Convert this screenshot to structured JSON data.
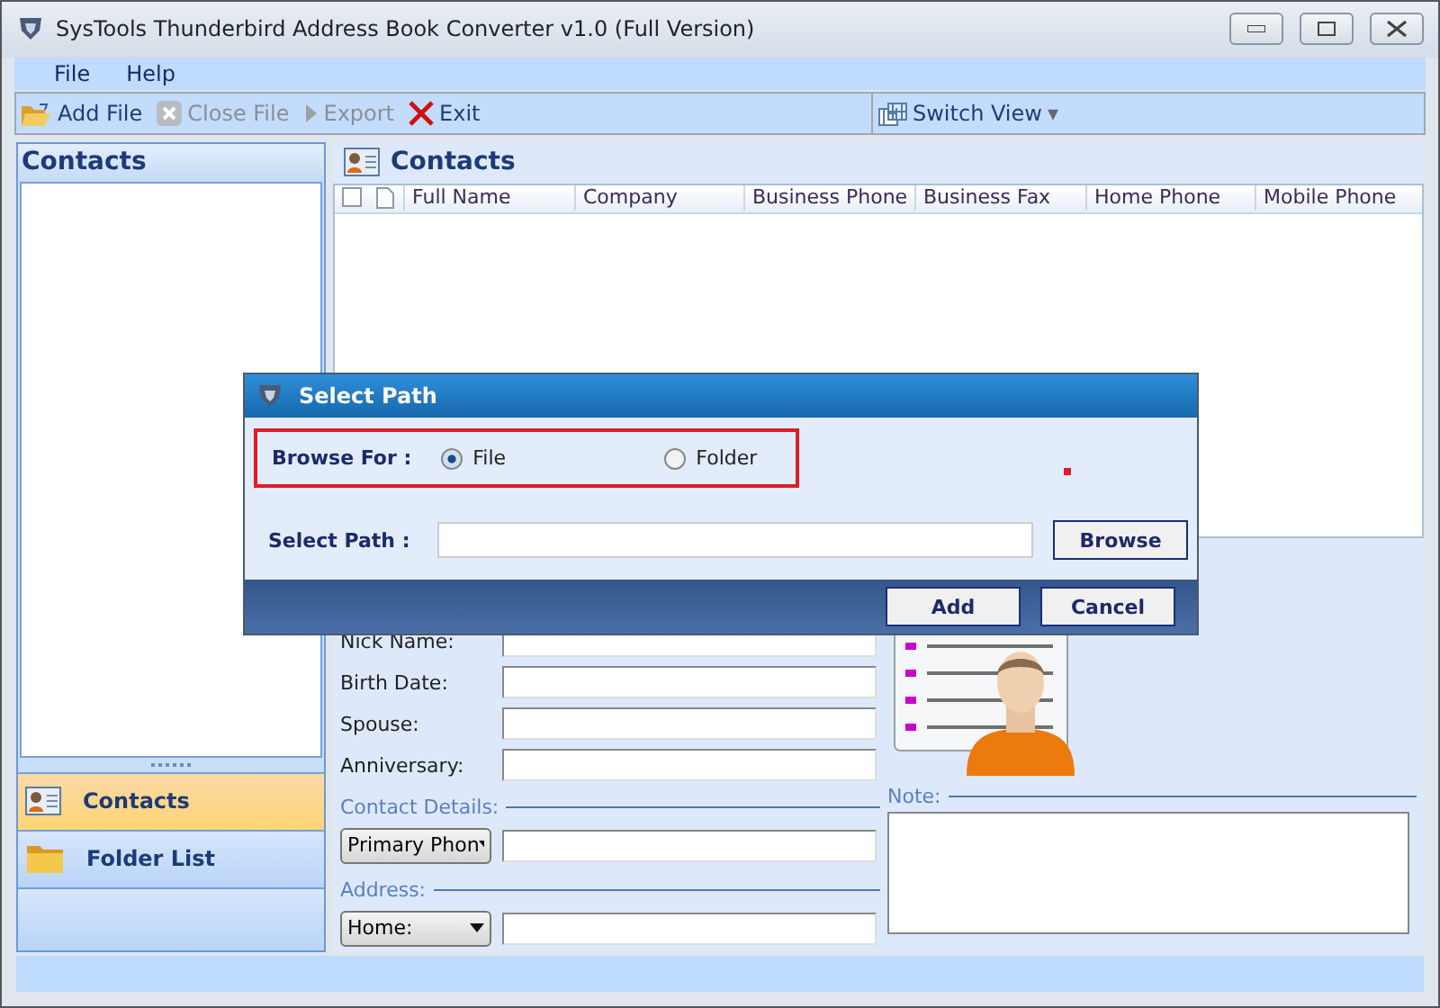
{
  "window": {
    "title": "SysTools Thunderbird Address Book Converter v1.0 (Full Version)"
  },
  "menu": [
    "File",
    "Help"
  ],
  "toolbar": [
    {
      "kind": "add",
      "label": "Add File",
      "disabled": false
    },
    {
      "kind": "close",
      "label": "Close File",
      "disabled": true
    },
    {
      "kind": "export",
      "label": "Export",
      "disabled": true
    },
    {
      "kind": "exit",
      "label": "Exit",
      "disabled": false
    }
  ],
  "switch_view": {
    "label": "Switch View",
    "caret": "▾"
  },
  "left_pane": {
    "title": "Contacts",
    "nav": [
      {
        "kind": "contacts",
        "label": "Contacts",
        "selected": true
      },
      {
        "kind": "folder",
        "label": "Folder List",
        "selected": false
      }
    ]
  },
  "main": {
    "title": "Contacts",
    "select_all": {
      "checked": false
    },
    "columns": [
      "Full Name",
      "Company",
      "Business Phone",
      "Business Fax",
      "Home Phone",
      "Mobile Phone"
    ],
    "fields": [
      "Nick Name:",
      "Birth Date:",
      "Spouse:",
      "Anniversary:"
    ],
    "contact_details": {
      "label": "Contact Details:",
      "dropdown": "Primary Phon"
    },
    "address": {
      "label": "Address:",
      "dropdown": "Home:"
    },
    "note": {
      "label": "Note:"
    }
  },
  "dialog": {
    "title": "Select Path",
    "browse_for": "Browse For :",
    "options": [
      {
        "label": "File",
        "selected": true
      },
      {
        "label": "Folder",
        "selected": false
      }
    ],
    "path_label": "Select Path :",
    "browse": "Browse",
    "buttons": [
      "Add",
      "Cancel"
    ]
  }
}
